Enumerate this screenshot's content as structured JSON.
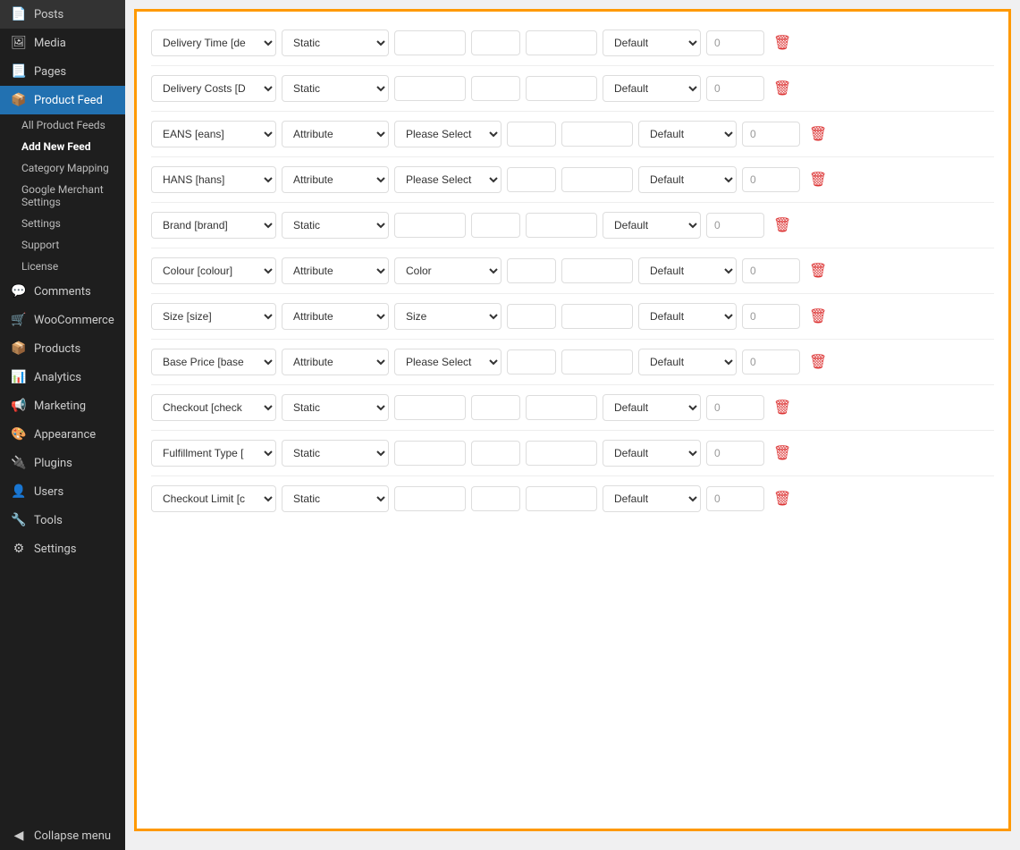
{
  "sidebar": {
    "items": [
      {
        "id": "posts",
        "label": "Posts",
        "icon": "📄",
        "active": false
      },
      {
        "id": "media",
        "label": "Media",
        "icon": "🖼",
        "active": false
      },
      {
        "id": "pages",
        "label": "Pages",
        "icon": "📃",
        "active": false
      },
      {
        "id": "product-feed",
        "label": "Product Feed",
        "icon": "📦",
        "active": true
      }
    ],
    "submenu": [
      {
        "id": "all-feeds",
        "label": "All Product Feeds",
        "bold": false
      },
      {
        "id": "add-new",
        "label": "Add New Feed",
        "bold": true
      },
      {
        "id": "category-mapping",
        "label": "Category Mapping",
        "bold": false
      },
      {
        "id": "google-merchant",
        "label": "Google Merchant Settings",
        "bold": false
      },
      {
        "id": "settings",
        "label": "Settings",
        "bold": false
      },
      {
        "id": "support",
        "label": "Support",
        "bold": false
      },
      {
        "id": "license",
        "label": "License",
        "bold": false
      }
    ],
    "bottom_items": [
      {
        "id": "comments",
        "label": "Comments",
        "icon": "💬"
      },
      {
        "id": "woocommerce",
        "label": "WooCommerce",
        "icon": "🛒"
      },
      {
        "id": "products",
        "label": "Products",
        "icon": "📦"
      },
      {
        "id": "analytics",
        "label": "Analytics",
        "icon": "📊"
      },
      {
        "id": "marketing",
        "label": "Marketing",
        "icon": "📢"
      },
      {
        "id": "appearance",
        "label": "Appearance",
        "icon": "🎨"
      },
      {
        "id": "plugins",
        "label": "Plugins",
        "icon": "🔌"
      },
      {
        "id": "users",
        "label": "Users",
        "icon": "👤"
      },
      {
        "id": "tools",
        "label": "Tools",
        "icon": "🔧"
      },
      {
        "id": "settings-main",
        "label": "Settings",
        "icon": "⚙"
      },
      {
        "id": "collapse",
        "label": "Collapse menu",
        "icon": "◀"
      }
    ]
  },
  "feed_rows": [
    {
      "id": "row1",
      "field_name": "Delivery Time [de",
      "type": "Static",
      "attr": "",
      "val1": "",
      "val2": "",
      "val3": "",
      "default": "Default",
      "num": "0"
    },
    {
      "id": "row2",
      "field_name": "Delivery Costs [D",
      "type": "Static",
      "attr": "",
      "val1": "",
      "val2": "",
      "val3": "",
      "default": "Default",
      "num": "0"
    },
    {
      "id": "row3",
      "field_name": "EANS [eans]",
      "type": "Attribute",
      "attr": "Please Select",
      "val1": "",
      "val2": "",
      "val3": "",
      "default": "Default",
      "num": "0"
    },
    {
      "id": "row4",
      "field_name": "HANS [hans]",
      "type": "Attribute",
      "attr": "Please Select",
      "val1": "",
      "val2": "",
      "val3": "",
      "default": "Default",
      "num": "0"
    },
    {
      "id": "row5",
      "field_name": "Brand [brand]",
      "type": "Static",
      "attr": "",
      "val1": "",
      "val2": "",
      "val3": "",
      "default": "Default",
      "num": "0"
    },
    {
      "id": "row6",
      "field_name": "Colour [colour]",
      "type": "Attribute",
      "attr": "Color",
      "val1": "",
      "val2": "",
      "val3": "",
      "default": "Default",
      "num": "0"
    },
    {
      "id": "row7",
      "field_name": "Size [size]",
      "type": "Attribute",
      "attr": "Size",
      "val1": "",
      "val2": "",
      "val3": "",
      "default": "Default",
      "num": "0"
    },
    {
      "id": "row8",
      "field_name": "Base Price [base",
      "type": "Attribute",
      "attr": "Please Select",
      "val1": "",
      "val2": "",
      "val3": "",
      "default": "Default",
      "num": "0"
    },
    {
      "id": "row9",
      "field_name": "Checkout [check",
      "type": "Static",
      "attr": "",
      "val1": "",
      "val2": "",
      "val3": "",
      "default": "Default",
      "num": "0"
    },
    {
      "id": "row10",
      "field_name": "Fulfillment Type [",
      "type": "Static",
      "attr": "",
      "val1": "",
      "val2": "",
      "val3": "",
      "default": "Default",
      "num": "0"
    },
    {
      "id": "row11",
      "field_name": "Checkout Limit [c",
      "type": "Static",
      "attr": "",
      "val1": "",
      "val2": "",
      "val3": "",
      "default": "Default",
      "num": "0"
    }
  ],
  "labels": {
    "delete": "🗑",
    "collapse_menu": "Collapse menu"
  }
}
